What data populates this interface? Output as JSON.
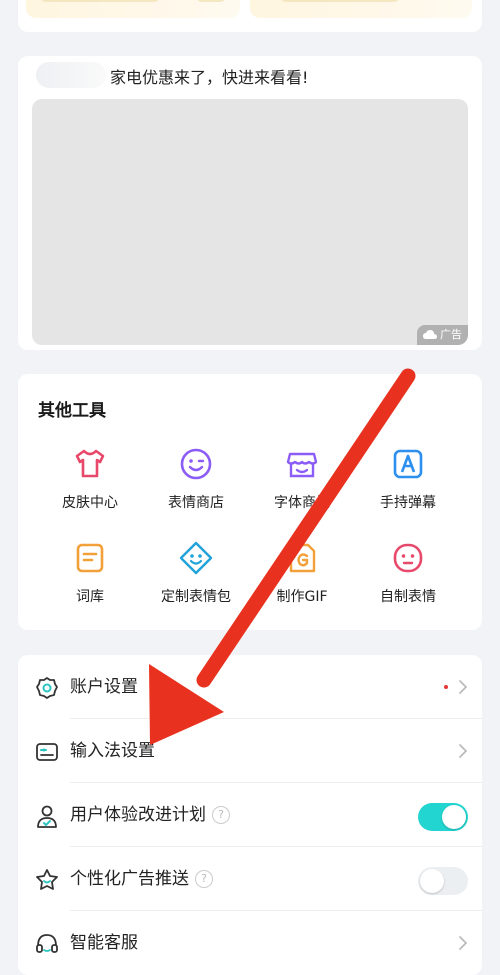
{
  "top_card": {
    "badge": ""
  },
  "ad": {
    "title": "家电优惠来了，快进来看看!",
    "tag_label": "广告"
  },
  "tools": {
    "title": "其他工具",
    "items": [
      {
        "label": "皮肤中心",
        "icon": "tshirt-icon",
        "color": "#e8496a"
      },
      {
        "label": "表情商店",
        "icon": "smiley-face-icon",
        "color": "#8b5cf6"
      },
      {
        "label": "字体商城",
        "icon": "store-icon",
        "color": "#8b5cf6"
      },
      {
        "label": "手持弹幕",
        "icon": "letter-a-icon",
        "color": "#2d8ff0"
      },
      {
        "label": "词库",
        "icon": "document-lines-icon",
        "color": "#f2a13a"
      },
      {
        "label": "定制表情包",
        "icon": "custom-emoji-icon",
        "color": "#1fa3d8"
      },
      {
        "label": "制作GIF",
        "icon": "gif-file-icon",
        "color": "#f2a13a"
      },
      {
        "label": "自制表情",
        "icon": "self-emoji-icon",
        "color": "#e8496a"
      }
    ]
  },
  "settings": {
    "items": [
      {
        "label": "账户设置",
        "icon": "gear-icon",
        "has_dot": true,
        "control": "chevron"
      },
      {
        "label": "输入法设置",
        "icon": "keyboard-icon",
        "control": "chevron"
      },
      {
        "label": "用户体验改进计划",
        "icon": "user-shield-icon",
        "help": "?",
        "control": "toggle",
        "toggle_on": true
      },
      {
        "label": "个性化广告推送",
        "icon": "star-badge-icon",
        "help": "?",
        "control": "toggle",
        "toggle_on": false
      },
      {
        "label": "智能客服",
        "icon": "headset-icon",
        "control": "chevron"
      }
    ]
  },
  "colors": {
    "accent_toggle": "#23d5d0",
    "arrow": "#e8321f",
    "dot": "#e53935"
  }
}
